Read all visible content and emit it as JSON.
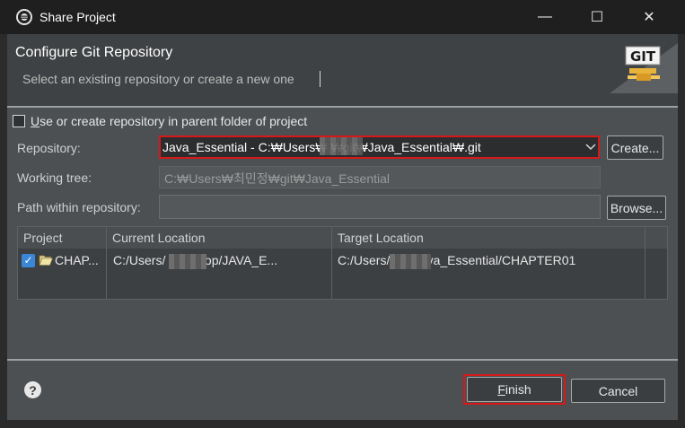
{
  "window": {
    "title": "Share Project",
    "controls": {
      "minimize": "—",
      "maximize": "☐",
      "close": "✕"
    }
  },
  "header": {
    "title": "Configure Git Repository",
    "subtitle": "Select an existing repository or create a new one",
    "logo_text": "GIT"
  },
  "form": {
    "parent_checkbox_label": "Use or create repository in parent folder of project",
    "parent_checkbox_checked": false,
    "repository_label": "Repository:",
    "repository_value": "Java_Essential - C:₩Users₩       ₩git₩Java_Essential₩.git",
    "create_label": "Create...",
    "working_tree_label": "Working tree:",
    "working_tree_value": "C:₩Users₩최민정₩git₩Java_Essential",
    "path_label": "Path within repository:",
    "path_value": "",
    "browse_label": "Browse..."
  },
  "table": {
    "columns": [
      "Project",
      "Current Location",
      "Target Location"
    ],
    "rows": [
      {
        "checked": true,
        "project": "CHAP...",
        "current": "C:/Users/         /Desktop/JAVA_E...",
        "target": "C:/Users/           /git/Java_Essential/CHAPTER01"
      }
    ]
  },
  "footer": {
    "help": "?",
    "finish_label": "Finish",
    "cancel_label": "Cancel"
  },
  "colors": {
    "highlight": "#d71818",
    "dialog_bg": "#4c5053",
    "titlebar_bg": "#1f1f1f",
    "checkbox_accent": "#3a86d8"
  }
}
